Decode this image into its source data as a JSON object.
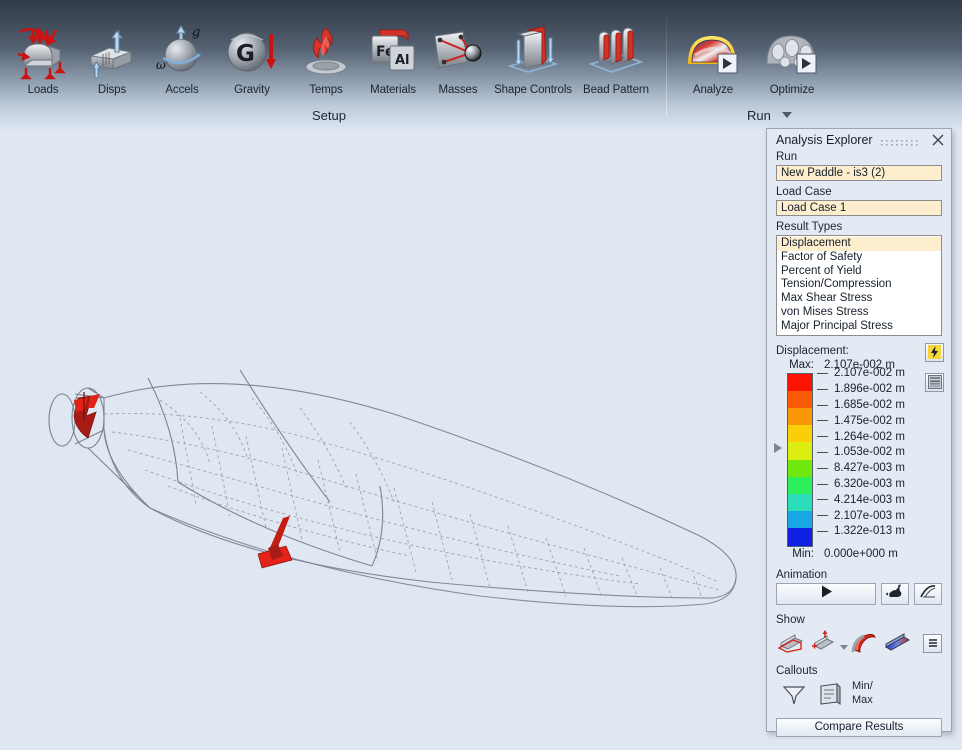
{
  "ribbon": {
    "groups": [
      {
        "name": "Setup",
        "label": "Setup"
      },
      {
        "name": "Run",
        "label": "Run"
      }
    ],
    "items": [
      {
        "icon": "loads-icon",
        "label": "Loads"
      },
      {
        "icon": "displacements-icon",
        "label": "Disps"
      },
      {
        "icon": "accelerations-icon",
        "label": "Accels"
      },
      {
        "icon": "gravity-icon",
        "label": "Gravity"
      },
      {
        "icon": "temperatures-icon",
        "label": "Temps"
      },
      {
        "icon": "materials-icon",
        "label": "Materials"
      },
      {
        "icon": "masses-icon",
        "label": "Masses"
      },
      {
        "icon": "shape-controls-icon",
        "label": "Shape Controls"
      },
      {
        "icon": "bead-pattern-icon",
        "label": "Bead Pattern"
      },
      {
        "icon": "analyze-icon",
        "label": "Analyze"
      },
      {
        "icon": "optimize-icon",
        "label": "Optimize"
      }
    ]
  },
  "panel": {
    "title": "Analysis Explorer",
    "grip_icon": "drag-grip-icon",
    "close_icon": "close-icon",
    "run": {
      "label": "Run",
      "value": "New Paddle - is3 (2)"
    },
    "load_case": {
      "label": "Load Case",
      "value": "Load Case 1"
    },
    "result_types": {
      "label": "Result Types",
      "selected": "Displacement",
      "options": [
        "Displacement",
        "Factor of Safety",
        "Percent of Yield",
        "Tension/Compression",
        "Max Shear Stress",
        "von Mises Stress",
        "Major Principal Stress"
      ]
    },
    "legend": {
      "title": "Displacement:",
      "max_label": "Max:",
      "max_value": "2.107e-002 m",
      "min_label": "Min:",
      "min_value": "0.000e+000 m",
      "unit": "m",
      "bolt_icon": "lightning-bolt-icon",
      "config_icon": "legend-settings-icon",
      "marker_icon": "band-marker-icon",
      "ticks": [
        "2.107e-002 m",
        "1.896e-002 m",
        "1.685e-002 m",
        "1.475e-002 m",
        "1.264e-002 m",
        "1.053e-002 m",
        "8.427e-003 m",
        "6.320e-003 m",
        "4.214e-003 m",
        "2.107e-003 m",
        "1.322e-013 m"
      ],
      "colors": [
        "#fb1403",
        "#fb5a05",
        "#fb9805",
        "#fbcf07",
        "#dced10",
        "#6ee80f",
        "#2ef05d",
        "#2cddba",
        "#1aa7e6",
        "#1020e2"
      ]
    },
    "animation": {
      "label": "Animation",
      "play_icon": "play-icon",
      "speed_icon": "rabbit-speed-icon",
      "curve_icon": "animation-curve-icon"
    },
    "show": {
      "label": "Show",
      "icons": [
        "show-deformed-wireframe-icon",
        "show-undeformed-icon",
        "show-deformed-shaded-icon",
        "show-contour-icon"
      ],
      "dropdown_icon": "chevron-down-icon",
      "menu_icon": "hamburger-menu-icon"
    },
    "callouts": {
      "label": "Callouts",
      "callout_icon": "callout-bubble-icon",
      "table_icon": "callout-table-icon",
      "minmax_line1": "Min/",
      "minmax_line2": "Max"
    },
    "compare_button": "Compare Results"
  },
  "canvas": {
    "model_name": "paddle-wireframe-model",
    "background": "#dfe7f2",
    "constraint_icon": "constraint-arrow-icon",
    "load_icon": "force-arrow-icon"
  }
}
